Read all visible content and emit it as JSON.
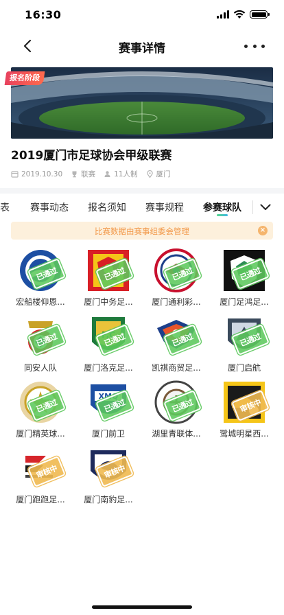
{
  "status_bar": {
    "time": "16:30"
  },
  "nav": {
    "title": "赛事详情",
    "back_icon": "chevron-left-icon",
    "more_icon": "more-dots-icon"
  },
  "banner": {
    "stage_badge": "报名阶段"
  },
  "event": {
    "title": "2019厦门市足球协会甲级联赛",
    "meta": [
      {
        "icon": "calendar-icon",
        "text": "2019.10.30"
      },
      {
        "icon": "trophy-icon",
        "text": "联赛"
      },
      {
        "icon": "people-icon",
        "text": "11人制"
      },
      {
        "icon": "location-icon",
        "text": "厦门"
      }
    ]
  },
  "tabs": [
    {
      "label": "表",
      "active": false
    },
    {
      "label": "赛事动态",
      "active": false
    },
    {
      "label": "报名须知",
      "active": false
    },
    {
      "label": "赛事规程",
      "active": false
    },
    {
      "label": "参赛球队",
      "active": true
    }
  ],
  "notice": {
    "text": "比赛数据由赛事组委会管理"
  },
  "colors": {
    "approved": "#5cc85c",
    "reviewing": "#f0b950",
    "notice_bg": "#fdf0dc",
    "notice_text": "#f2994a"
  },
  "teams": [
    {
      "name": "宏船楼仰恩...",
      "status": "已通过"
    },
    {
      "name": "厦门中务足...",
      "status": "已通过"
    },
    {
      "name": "厦门通利彩...",
      "status": "已通过"
    },
    {
      "name": "厦门足鸿足...",
      "status": "已通过"
    },
    {
      "name": "同安人队",
      "status": "已通过"
    },
    {
      "name": "厦门洛克足...",
      "status": "已通过"
    },
    {
      "name": "凯祺商贸足...",
      "status": "已通过"
    },
    {
      "name": "厦门启航",
      "status": "已通过"
    },
    {
      "name": "厦门精英球...",
      "status": "已通过"
    },
    {
      "name": "厦门前卫",
      "status": "已通过"
    },
    {
      "name": "湖里青联体...",
      "status": "已通过"
    },
    {
      "name": "鹭城明星西...",
      "status": "审核中"
    },
    {
      "name": "厦门跑跑足...",
      "status": "审核中"
    },
    {
      "name": "厦门南豹足...",
      "status": "审核中"
    }
  ]
}
